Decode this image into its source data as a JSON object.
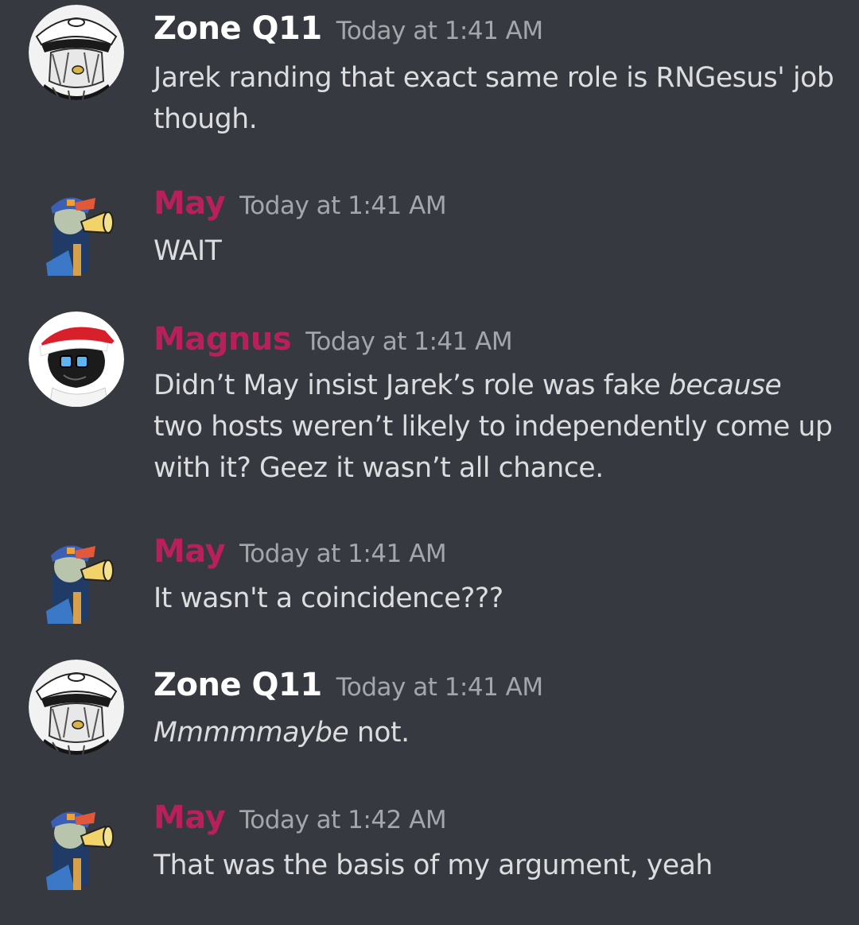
{
  "colors": {
    "background": "#36393f",
    "text": "#dcddde",
    "timestamp": "#a3a6aa",
    "zone_name": "#ffffff",
    "pink_name": "#b8205c"
  },
  "messages": [
    {
      "author": "Zone Q11",
      "timestamp": "Today at 1:41 AM",
      "avatar_icon": "zone-q11-avatar-icon",
      "text": "Jarek randing that exact same role is RNGesus' job though."
    },
    {
      "author": "May",
      "timestamp": "Today at 1:41 AM",
      "avatar_icon": "may-avatar-icon",
      "text": "WAIT"
    },
    {
      "author": "Magnus",
      "timestamp": "Today at 1:41 AM",
      "avatar_icon": "magnus-avatar-icon",
      "text_before": "Didn’t May insist Jarek’s role was fake ",
      "text_italic": "because",
      "text_after": " two hosts weren’t likely to independently come up with it? Geez it wasn’t all chance."
    },
    {
      "author": "May",
      "timestamp": "Today at 1:41 AM",
      "avatar_icon": "may-avatar-icon",
      "text": "It wasn't a coincidence???"
    },
    {
      "author": "Zone Q11",
      "timestamp": "Today at 1:41 AM",
      "avatar_icon": "zone-q11-avatar-icon",
      "text_italic": "Mmmmmaybe",
      "text_after": " not."
    },
    {
      "author": "May",
      "timestamp": "Today at 1:42 AM",
      "avatar_icon": "may-avatar-icon",
      "text": "That was the basis of my argument, yeah"
    }
  ]
}
